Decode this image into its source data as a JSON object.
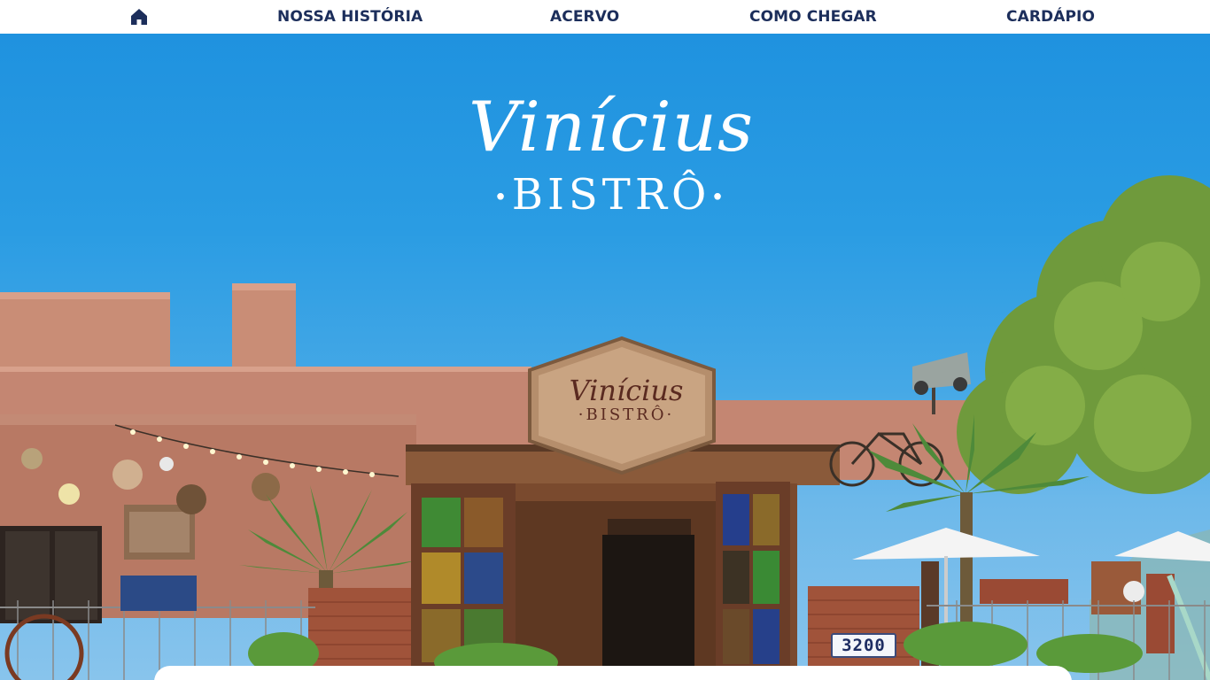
{
  "nav": {
    "home_icon": "home-icon",
    "items": [
      {
        "label": "NOSSA HISTÓRIA"
      },
      {
        "label": "ACERVO"
      },
      {
        "label": "COMO CHEGAR"
      },
      {
        "label": "CARDÁPIO"
      }
    ],
    "color": "#1c2e5b"
  },
  "hero": {
    "logo": {
      "main": "Vinícius",
      "sub": "BISTRÔ",
      "color": "#ffffff"
    },
    "sign": {
      "main": "Vinícius",
      "sub": "·BISTRÔ·"
    },
    "house_number": "3200",
    "sky_color": "#2a9ce3"
  }
}
